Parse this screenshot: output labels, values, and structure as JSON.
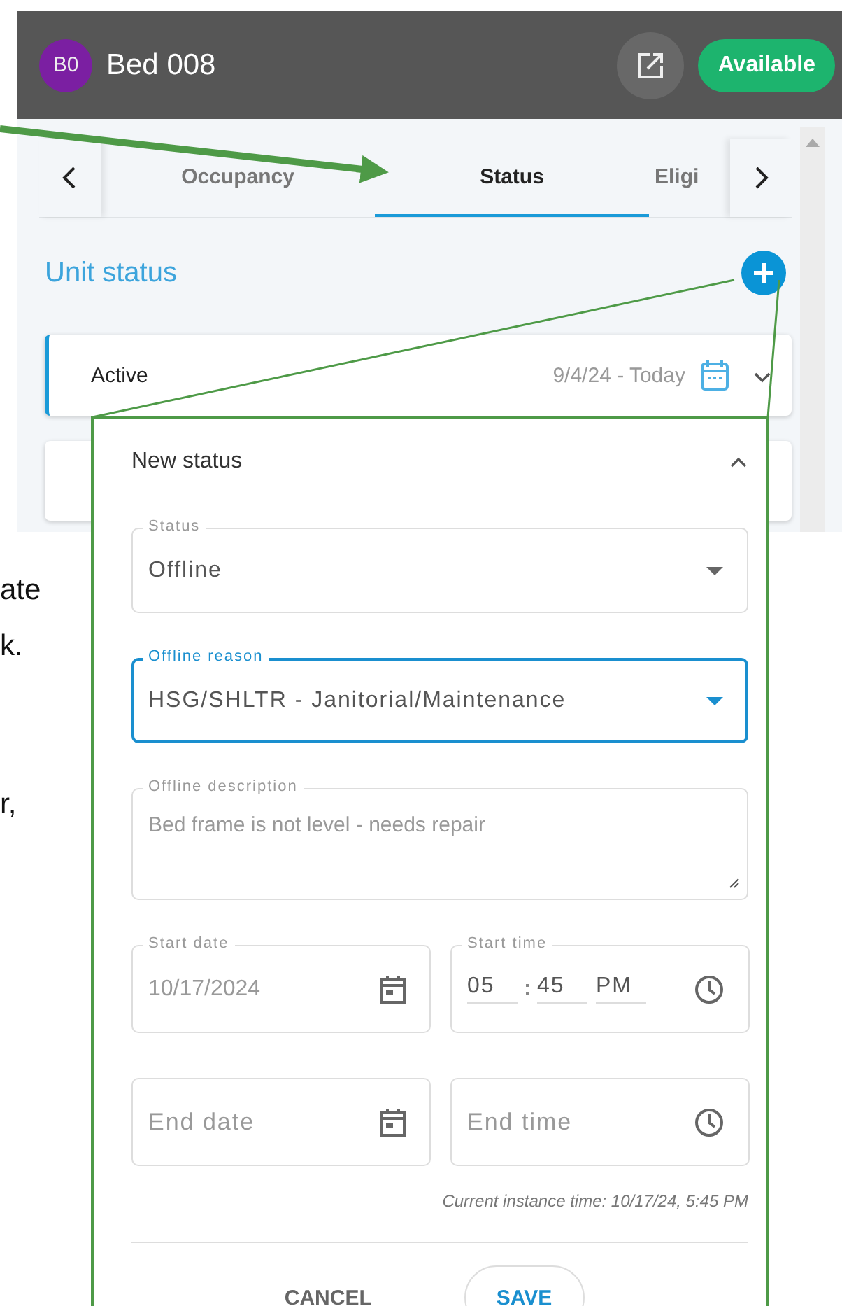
{
  "header": {
    "avatar": "B0",
    "title": "Bed 008",
    "status_badge": "Available"
  },
  "tabs": [
    {
      "label": "Occupancy",
      "selected": false
    },
    {
      "label": "Status",
      "selected": true
    },
    {
      "label": "Eligi",
      "selected": false
    }
  ],
  "section_title": "Unit status",
  "status_cards": [
    {
      "label": "Active",
      "date_range": "9/4/24 - Today",
      "selected": true
    }
  ],
  "side_text": [
    [
      "ate",
      "k."
    ],
    [
      "r,"
    ]
  ],
  "new_status": {
    "title": "New status",
    "expanded": true,
    "status_field": {
      "label": "Status",
      "value": "Offline",
      "focused": false
    },
    "reason_field": {
      "label": "Offline reason",
      "value": "HSG/SHLTR - Janitorial/Maintenance",
      "focused": true
    },
    "description_field": {
      "label": "Offline description",
      "placeholder": "Bed frame is not level - needs repair"
    },
    "start_date": {
      "label": "Start date",
      "value": "10/17/2024"
    },
    "start_time": {
      "label": "Start time",
      "hour": "05",
      "minute": "45",
      "period": "PM"
    },
    "end_date": {
      "placeholder": "End date"
    },
    "end_time": {
      "placeholder": "End time"
    },
    "note": "Current instance time: 10/17/24, 5:45 PM",
    "buttons": [
      {
        "label": "CANCEL",
        "kind": "text"
      },
      {
        "label": "SAVE",
        "kind": "outlined"
      }
    ]
  }
}
